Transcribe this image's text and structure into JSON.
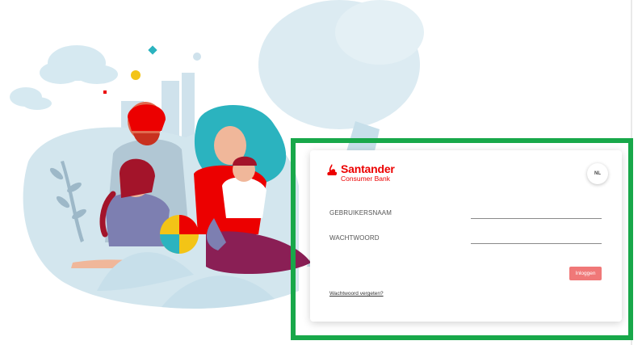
{
  "brand": {
    "name": "Santander",
    "subtitle": "Consumer Bank",
    "color": "#ec0000"
  },
  "language_button": {
    "label": "NL"
  },
  "form": {
    "username_label": "GEBRUIKERSNAAM",
    "username_value": "",
    "password_label": "WACHTWOORD",
    "password_value": "",
    "login_label": "Inloggen",
    "forgot_password_link": "Wachtwoord vergeten?"
  },
  "colors": {
    "highlight_border": "#18a84a",
    "login_button": "#f07878",
    "accent_red": "#ec0000",
    "teal": "#2bb3bf"
  },
  "icons": [
    "santander-flame-icon"
  ]
}
